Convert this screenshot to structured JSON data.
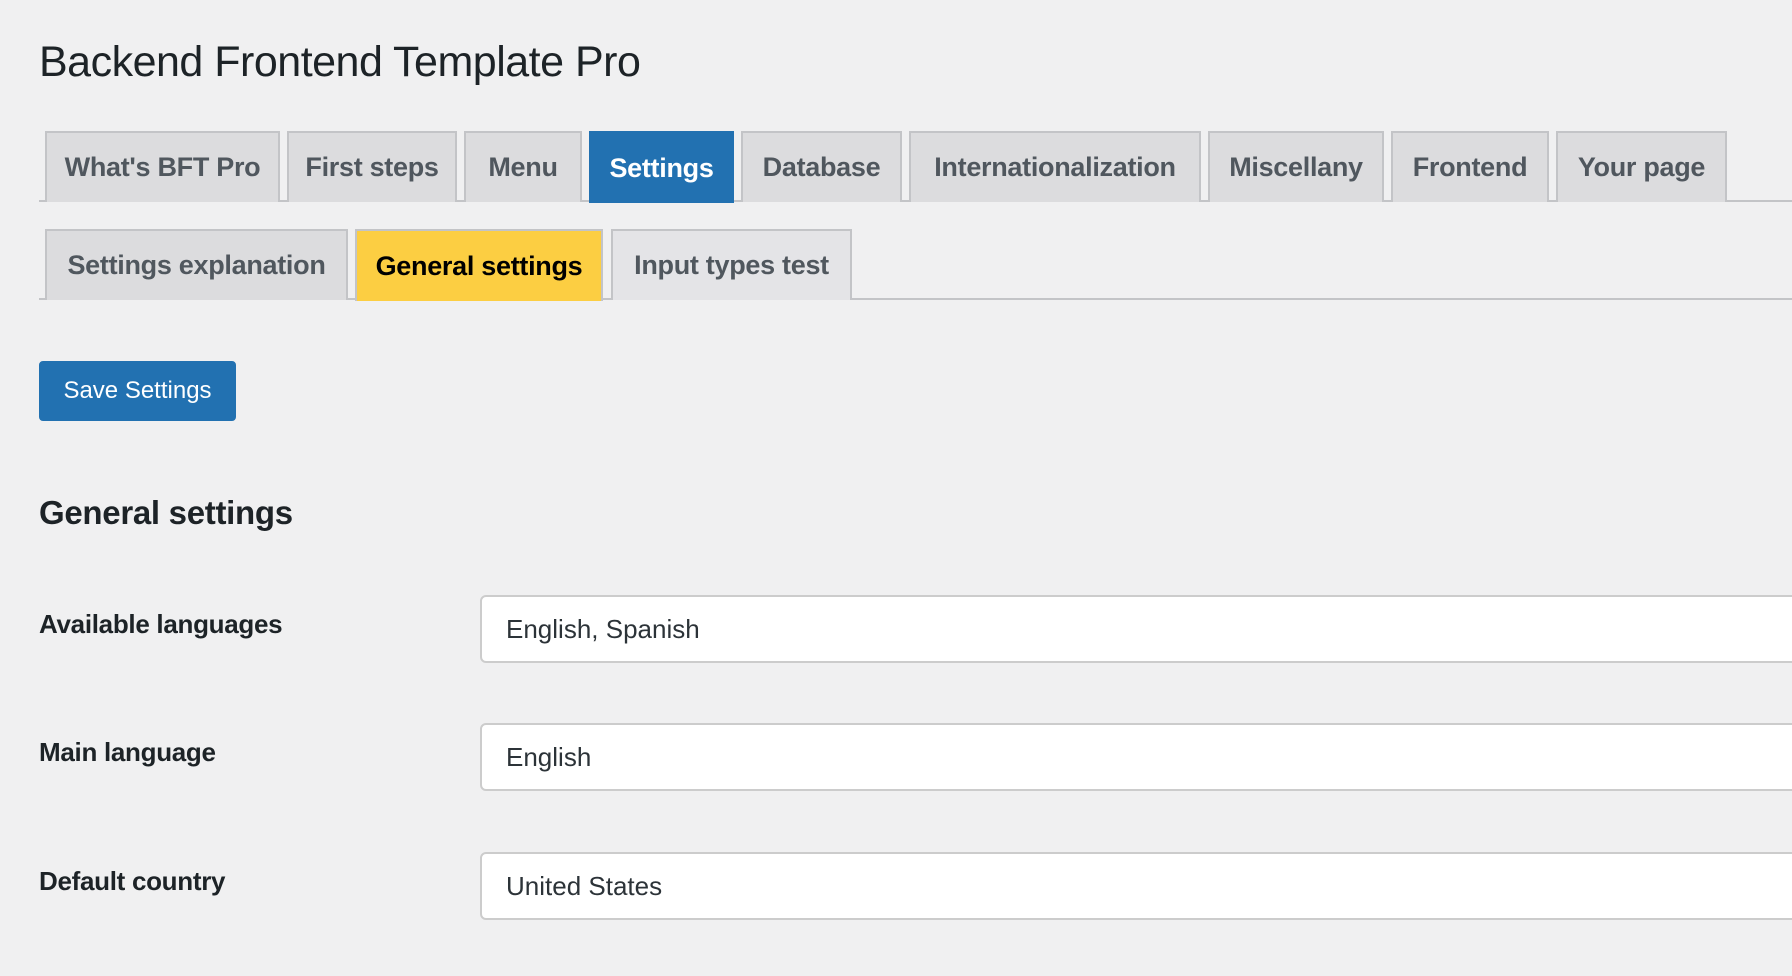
{
  "page": {
    "title": "Backend Frontend Template Pro"
  },
  "main_tabs": [
    {
      "label": "What's BFT Pro",
      "active": false
    },
    {
      "label": "First steps",
      "active": false
    },
    {
      "label": "Menu",
      "active": false
    },
    {
      "label": "Settings",
      "active": true
    },
    {
      "label": "Database",
      "active": false
    },
    {
      "label": "Internationalization",
      "active": false
    },
    {
      "label": "Miscellany",
      "active": false
    },
    {
      "label": "Frontend",
      "active": false
    },
    {
      "label": "Your page",
      "active": false
    }
  ],
  "sub_tabs": [
    {
      "label": "Settings explanation",
      "active": false
    },
    {
      "label": "General settings",
      "active": true
    },
    {
      "label": "Input types test",
      "active": false
    }
  ],
  "toolbar": {
    "save_label": "Save Settings"
  },
  "section": {
    "title": "General settings"
  },
  "fields": [
    {
      "label": "Available languages",
      "value": "English, Spanish"
    },
    {
      "label": "Main language",
      "value": "English"
    },
    {
      "label": "Default country",
      "value": "United States"
    }
  ],
  "colors": {
    "primary": "#2271b1",
    "active_subtab": "#fcce42",
    "background": "#f0f0f1",
    "tab_inactive": "#dcdcde"
  }
}
